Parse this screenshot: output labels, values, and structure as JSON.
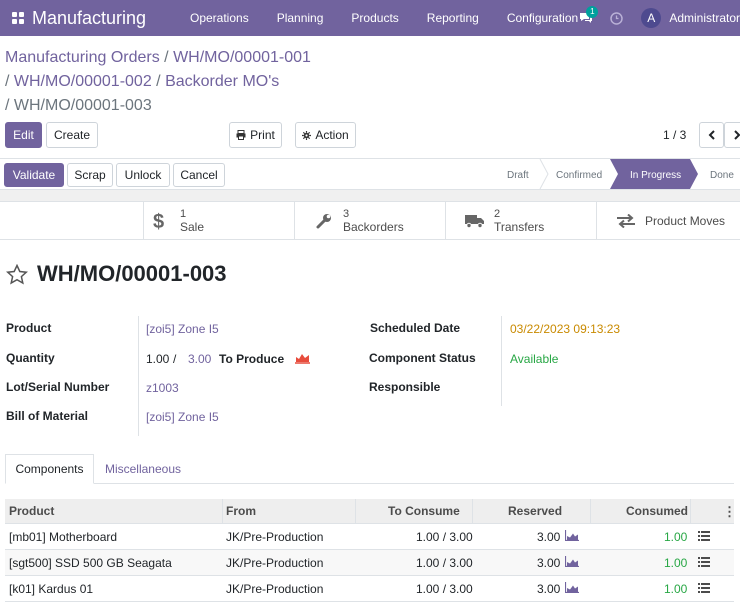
{
  "navbar": {
    "brand": "Manufacturing",
    "menu": [
      "Operations",
      "Planning",
      "Products",
      "Reporting",
      "Configuration"
    ],
    "chat_badge": "1",
    "avatar_letter": "A",
    "user": "Administrator"
  },
  "breadcrumb": {
    "items": [
      "Manufacturing Orders",
      "WH/MO/00001-001",
      "WH/MO/00001-002",
      "Backorder MO's"
    ],
    "current": "WH/MO/00001-003"
  },
  "control": {
    "edit": "Edit",
    "create": "Create",
    "print": "Print",
    "action": "Action",
    "pager": "1 / 3"
  },
  "statusbar": {
    "buttons": {
      "validate": "Validate",
      "scrap": "Scrap",
      "unlock": "Unlock",
      "cancel": "Cancel"
    },
    "stages": [
      "Draft",
      "Confirmed",
      "In Progress",
      "Done"
    ],
    "active_stage": "In Progress"
  },
  "smart_buttons": [
    {
      "count": "1",
      "label": "Sale",
      "icon": "dollar-icon"
    },
    {
      "count": "3",
      "label": "Backorders",
      "icon": "wrench-icon"
    },
    {
      "count": "2",
      "label": "Transfers",
      "icon": "truck-icon"
    },
    {
      "count": "",
      "label": "Product Moves",
      "icon": "exchange-arrows-icon"
    }
  ],
  "record": {
    "title": "WH/MO/00001-003",
    "fields_left": {
      "product_label": "Product",
      "product_value": "[zoi5] Zone I5",
      "quantity_label": "Quantity",
      "quantity_value": "1.00",
      "quantity_sep": "/",
      "quantity_total": "3.00",
      "quantity_suffix": "To Produce",
      "lot_label": "Lot/Serial Number",
      "lot_value": "z1003",
      "bom_label": "Bill of Material",
      "bom_value": "[zoi5] Zone I5"
    },
    "fields_right": {
      "scheduled_label": "Scheduled Date",
      "scheduled_value": "03/22/2023 09:13:23",
      "component_status_label": "Component Status",
      "component_status_value": "Available",
      "responsible_label": "Responsible",
      "responsible_value": ""
    }
  },
  "tabs": [
    "Components",
    "Miscellaneous"
  ],
  "table": {
    "headers": [
      "Product",
      "From",
      "To Consume",
      "Reserved",
      "Consumed"
    ],
    "rows": [
      {
        "product": "[mb01] Motherboard",
        "from": "JK/Pre-Production",
        "to_consume": "1.00 / 3.00",
        "reserved": "3.00",
        "consumed": "1.00"
      },
      {
        "product": "[sgt500] SSD 500 GB Seagata",
        "from": "JK/Pre-Production",
        "to_consume": "1.00 / 3.00",
        "reserved": "3.00",
        "consumed": "1.00"
      },
      {
        "product": "[k01] Kardus 01",
        "from": "JK/Pre-Production",
        "to_consume": "1.00 / 3.00",
        "reserved": "3.00",
        "consumed": "1.00"
      }
    ]
  },
  "colors": {
    "brand": "#71639e",
    "scheduled": "#c98a00",
    "available": "#28a745",
    "forecast": "#e74c3c"
  }
}
